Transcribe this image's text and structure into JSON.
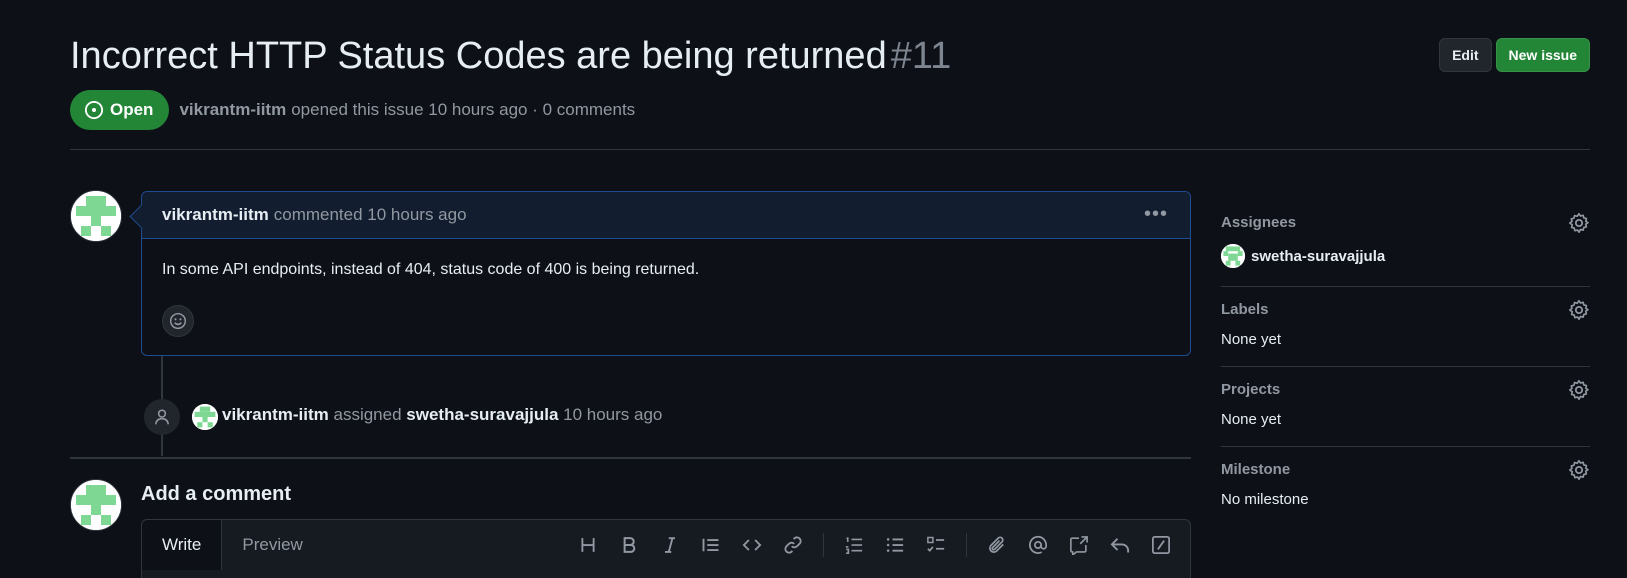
{
  "issue": {
    "title": "Incorrect HTTP Status Codes are being returned",
    "number": "#11",
    "state": "Open",
    "author": "vikrantm-iitm",
    "meta_text": "opened this issue 10 hours ago · 0 comments"
  },
  "header_actions": {
    "edit_label": "Edit",
    "new_issue_label": "New issue"
  },
  "comment": {
    "author": "vikrantm-iitm",
    "when": "commented 10 hours ago",
    "body": "In some API endpoints, instead of 404, status code of 400 is being returned."
  },
  "event": {
    "actor": "vikrantm-iitm",
    "action": "assigned",
    "target": "swetha-suravajjula",
    "when": "10 hours ago"
  },
  "composer": {
    "title": "Add a comment",
    "tab_write": "Write",
    "tab_preview": "Preview",
    "toolbar_icons": [
      "heading-icon",
      "bold-icon",
      "italic-icon",
      "quote-icon",
      "code-icon",
      "link-icon",
      "numbered-list-icon",
      "bulleted-list-icon",
      "task-list-icon",
      "attach-icon",
      "mention-icon",
      "cross-reference-icon",
      "reply-icon",
      "slash-command-icon"
    ]
  },
  "sidebar": {
    "assignees_label": "Assignees",
    "assignee": "swetha-suravajjula",
    "labels_label": "Labels",
    "labels_value": "None yet",
    "projects_label": "Projects",
    "projects_value": "None yet",
    "milestone_label": "Milestone",
    "milestone_value": "No milestone"
  },
  "colors": {
    "background": "#0d1117",
    "open_green": "#238636",
    "comment_border": "#1f4b8f",
    "comment_header_bg": "#121d2f",
    "muted_text": "#9198a1",
    "avatar_green": "#7ed894"
  }
}
